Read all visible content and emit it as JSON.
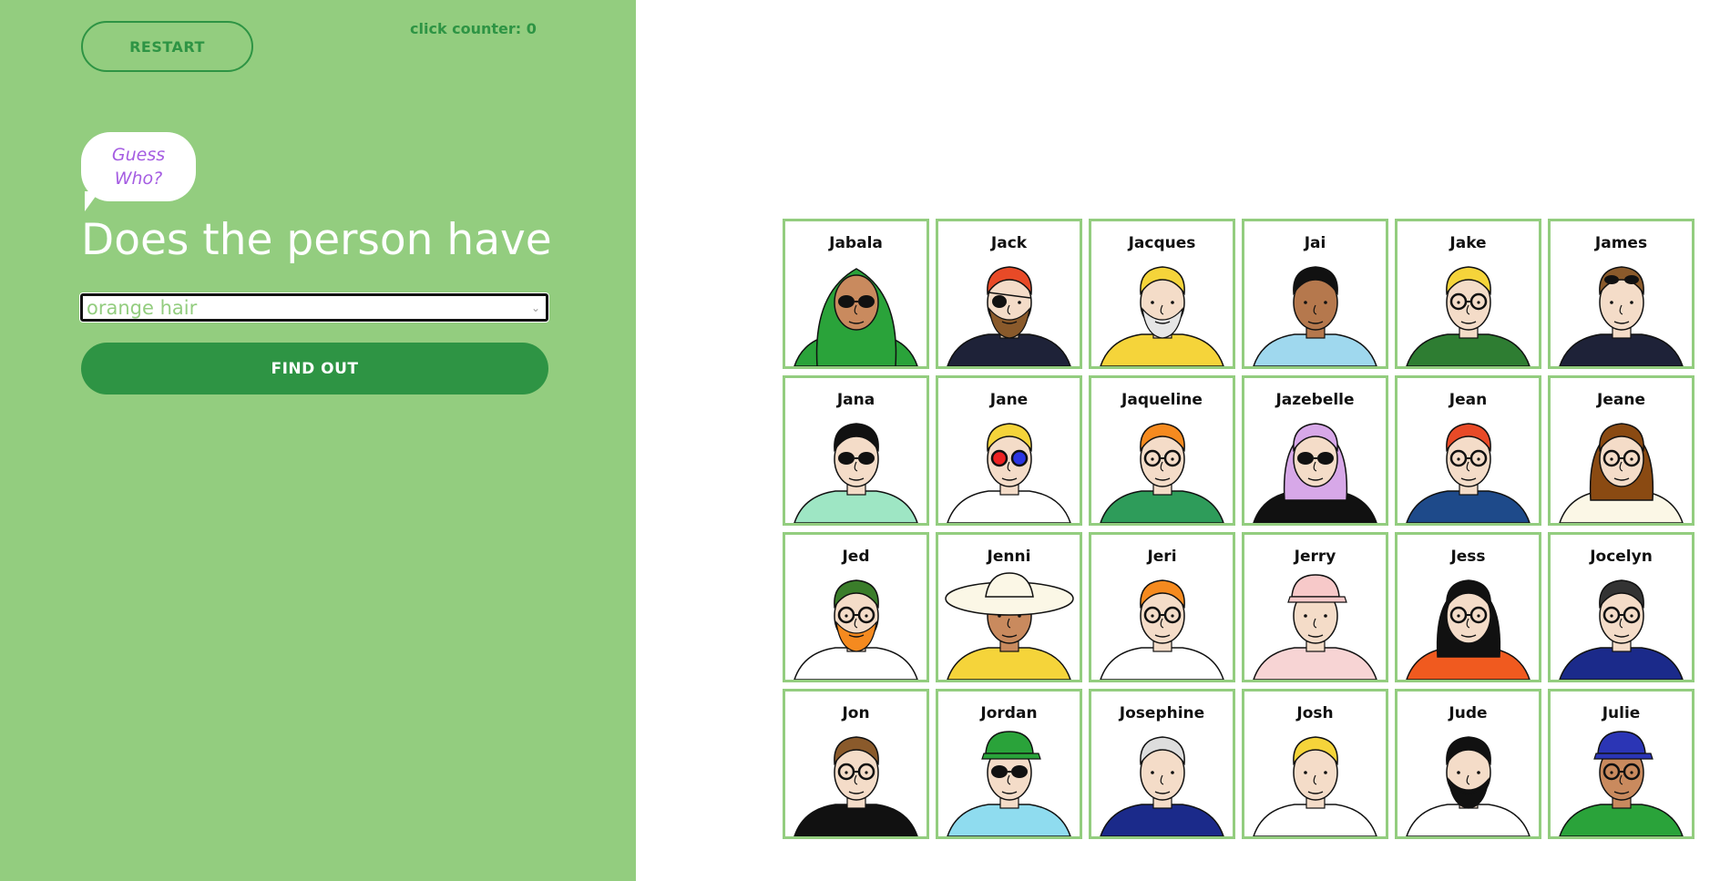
{
  "sidebar": {
    "restart_label": "RESTART",
    "counter_text": "click counter: 0",
    "bubble_line1": "Guess",
    "bubble_line2": "Who?",
    "question": "Does the person have",
    "select_value": "orange hair",
    "find_label": "FIND OUT"
  },
  "colors": {
    "sidebar_bg": "#93cd7f",
    "accent_dark": "#2e9444",
    "card_border": "#93cd7f",
    "bubble_text": "#a55de2"
  },
  "board": {
    "characters": [
      {
        "name": "Jabala",
        "hair": "#2aa33a",
        "skin": "#c98a5e",
        "shirt": "#2aa33a",
        "glasses": "sun",
        "scarf": true
      },
      {
        "name": "Jack",
        "hair": "#e84a27",
        "skin": "#f4dcc8",
        "shirt": "#1e2238",
        "glasses": "eyepatch",
        "beard": "#8a5a2b"
      },
      {
        "name": "Jacques",
        "hair": "#f5d43a",
        "skin": "#f4dcc8",
        "shirt": "#f5d43a",
        "glasses": "none",
        "beard": "#e6e6e6"
      },
      {
        "name": "Jai",
        "hair": "#111111",
        "skin": "#b5784d",
        "shirt": "#9fd8ee",
        "glasses": "none"
      },
      {
        "name": "Jake",
        "hair": "#f5d43a",
        "skin": "#f4dcc8",
        "shirt": "#2e7d32",
        "glasses": "clear"
      },
      {
        "name": "James",
        "hair": "#8a5a2b",
        "skin": "#f4dcc8",
        "shirt": "#1e2238",
        "glasses": "sun-on-head"
      },
      {
        "name": "Jana",
        "hair": "#111111",
        "skin": "#f4dcc8",
        "shirt": "#9ee6c4",
        "glasses": "sun"
      },
      {
        "name": "Jane",
        "hair": "#f5d43a",
        "skin": "#f4dcc8",
        "shirt": "#ffffff",
        "glasses": "3d"
      },
      {
        "name": "Jaqueline",
        "hair": "#f58a1f",
        "skin": "#f4dcc8",
        "shirt": "#2e9c5a",
        "glasses": "clear"
      },
      {
        "name": "Jazebelle",
        "hair": "#d7a8e8",
        "skin": "#f4dcc8",
        "shirt": "#111111",
        "glasses": "sun"
      },
      {
        "name": "Jean",
        "hair": "#e84a27",
        "skin": "#f4dcc8",
        "shirt": "#1e4a8a",
        "glasses": "clear"
      },
      {
        "name": "Jeane",
        "hair": "#8a4a12",
        "skin": "#f4dcc8",
        "shirt": "#fbf7e6",
        "glasses": "clear"
      },
      {
        "name": "Jed",
        "hair": "#3a7d2a",
        "skin": "#f4dcc8",
        "shirt": "#ffffff",
        "glasses": "clear",
        "beard": "#f58a1f"
      },
      {
        "name": "Jenni",
        "hair": "#fbf7e6",
        "skin": "#c98a5e",
        "shirt": "#f5d43a",
        "glasses": "none",
        "hat": "wide"
      },
      {
        "name": "Jeri",
        "hair": "#f58a1f",
        "skin": "#f4dcc8",
        "shirt": "#ffffff",
        "glasses": "clear"
      },
      {
        "name": "Jerry",
        "hair": "#f7c9c9",
        "skin": "#f4dcc8",
        "shirt": "#f7d4d4",
        "glasses": "none",
        "hat": "cap"
      },
      {
        "name": "Jess",
        "hair": "#111111",
        "skin": "#f4dcc8",
        "shirt": "#f05a1f",
        "glasses": "clear"
      },
      {
        "name": "Jocelyn",
        "hair": "#333333",
        "skin": "#f4dcc8",
        "shirt": "#1b2a8a",
        "glasses": "clear"
      },
      {
        "name": "Jon",
        "hair": "#8a5a2b",
        "skin": "#f4dcc8",
        "shirt": "#111111",
        "glasses": "clear"
      },
      {
        "name": "Jordan",
        "hair": "#2aa33a",
        "skin": "#f4dcc8",
        "shirt": "#8fdcef",
        "glasses": "sun",
        "hat": "cap"
      },
      {
        "name": "Josephine",
        "hair": "#dddddd",
        "skin": "#f4dcc8",
        "shirt": "#1b2a8a",
        "glasses": "none"
      },
      {
        "name": "Josh",
        "hair": "#f5d43a",
        "skin": "#f4dcc8",
        "shirt": "#ffffff",
        "glasses": "none"
      },
      {
        "name": "Jude",
        "hair": "#111111",
        "skin": "#f4dcc8",
        "shirt": "#ffffff",
        "glasses": "none",
        "beard": "#111111"
      },
      {
        "name": "Julie",
        "hair": "#222222",
        "skin": "#c98a5e",
        "shirt": "#2aa33a",
        "glasses": "clear",
        "hat": "cap-blue"
      }
    ]
  }
}
